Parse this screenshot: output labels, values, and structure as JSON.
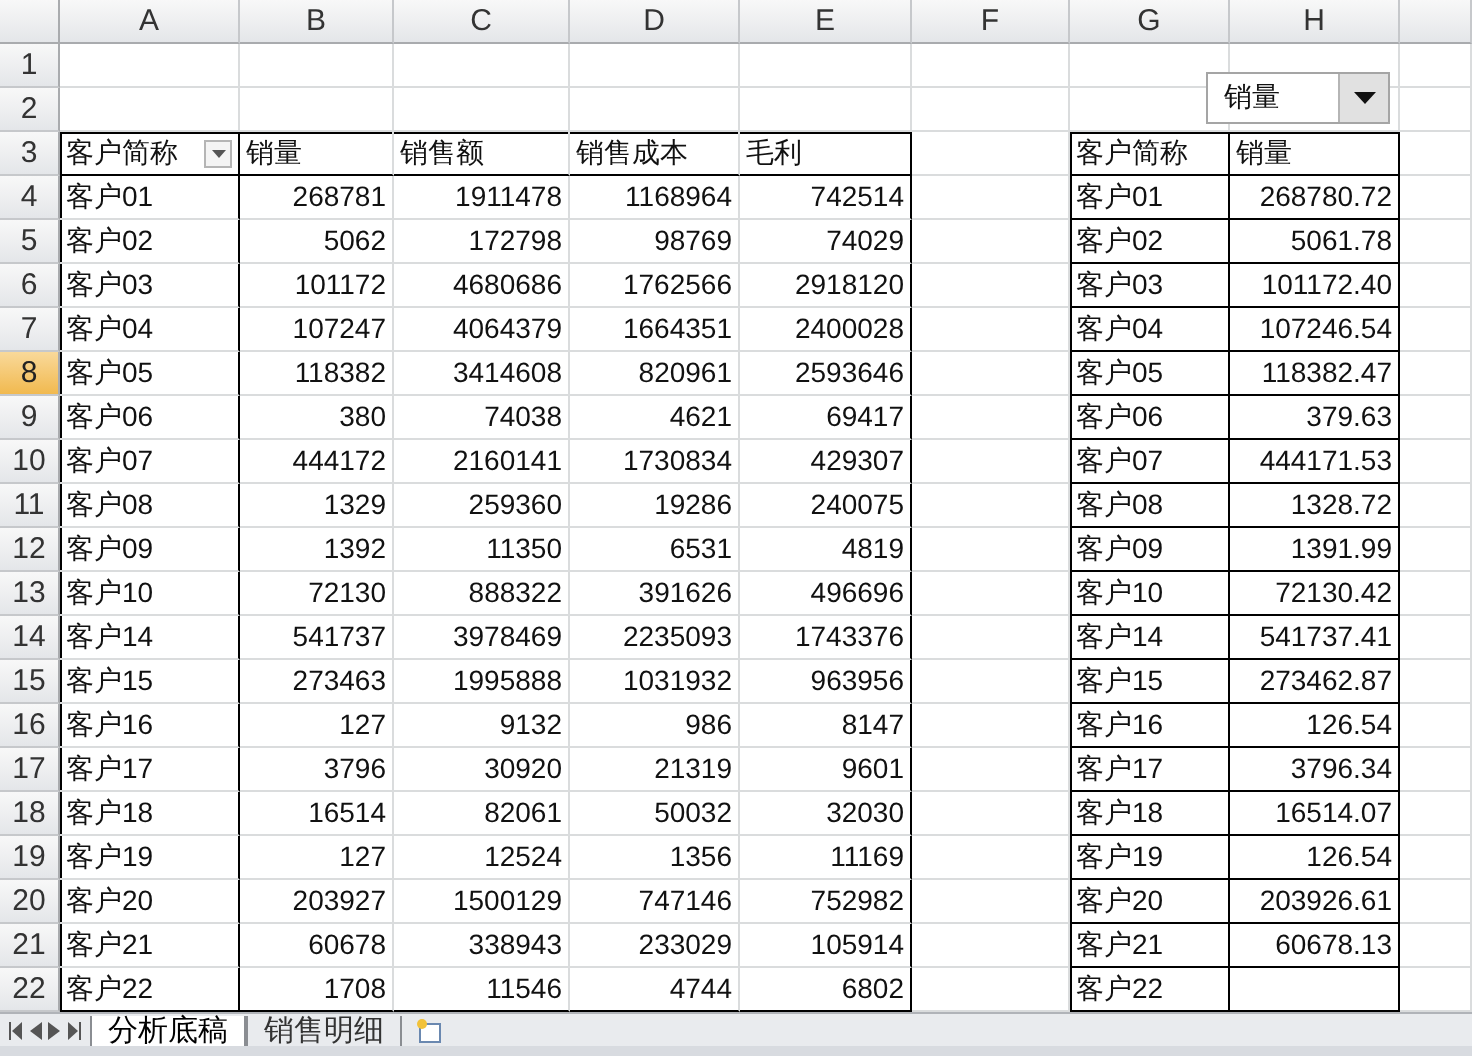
{
  "column_headers": [
    {
      "label": "A"
    },
    {
      "label": "B"
    },
    {
      "label": "C"
    },
    {
      "label": "D"
    },
    {
      "label": "E"
    },
    {
      "label": "F"
    },
    {
      "label": "G"
    },
    {
      "label": "H"
    }
  ],
  "row_headers": [
    {
      "label": "1",
      "selected": false
    },
    {
      "label": "2",
      "selected": false
    },
    {
      "label": "3",
      "selected": false
    },
    {
      "label": "4",
      "selected": false
    },
    {
      "label": "5",
      "selected": false
    },
    {
      "label": "6",
      "selected": false
    },
    {
      "label": "7",
      "selected": false
    },
    {
      "label": "8",
      "selected": true
    },
    {
      "label": "9",
      "selected": false
    },
    {
      "label": "10",
      "selected": false
    },
    {
      "label": "11",
      "selected": false
    },
    {
      "label": "12",
      "selected": false
    },
    {
      "label": "13",
      "selected": false
    },
    {
      "label": "14",
      "selected": false
    },
    {
      "label": "15",
      "selected": false
    },
    {
      "label": "16",
      "selected": false
    },
    {
      "label": "17",
      "selected": false
    },
    {
      "label": "18",
      "selected": false
    },
    {
      "label": "19",
      "selected": false
    },
    {
      "label": "20",
      "selected": false
    },
    {
      "label": "21",
      "selected": false
    },
    {
      "label": "22",
      "selected": false
    }
  ],
  "dropdown": {
    "value": "销量"
  },
  "left_table": {
    "header": [
      {
        "label": "客户简称",
        "filter": true
      },
      {
        "label": "销量",
        "filter": false
      },
      {
        "label": "销售额",
        "filter": false
      },
      {
        "label": "销售成本",
        "filter": false
      },
      {
        "label": "毛利",
        "filter": false
      }
    ],
    "rows": [
      [
        "客户01",
        "268781",
        "1911478",
        "1168964",
        "742514"
      ],
      [
        "客户02",
        "5062",
        "172798",
        "98769",
        "74029"
      ],
      [
        "客户03",
        "101172",
        "4680686",
        "1762566",
        "2918120"
      ],
      [
        "客户04",
        "107247",
        "4064379",
        "1664351",
        "2400028"
      ],
      [
        "客户05",
        "118382",
        "3414608",
        "820961",
        "2593646"
      ],
      [
        "客户06",
        "380",
        "74038",
        "4621",
        "69417"
      ],
      [
        "客户07",
        "444172",
        "2160141",
        "1730834",
        "429307"
      ],
      [
        "客户08",
        "1329",
        "259360",
        "19286",
        "240075"
      ],
      [
        "客户09",
        "1392",
        "11350",
        "6531",
        "4819"
      ],
      [
        "客户10",
        "72130",
        "888322",
        "391626",
        "496696"
      ],
      [
        "客户14",
        "541737",
        "3978469",
        "2235093",
        "1743376"
      ],
      [
        "客户15",
        "273463",
        "1995888",
        "1031932",
        "963956"
      ],
      [
        "客户16",
        "127",
        "9132",
        "986",
        "8147"
      ],
      [
        "客户17",
        "3796",
        "30920",
        "21319",
        "9601"
      ],
      [
        "客户18",
        "16514",
        "82061",
        "50032",
        "32030"
      ],
      [
        "客户19",
        "127",
        "12524",
        "1356",
        "11169"
      ],
      [
        "客户20",
        "203927",
        "1500129",
        "747146",
        "752982"
      ],
      [
        "客户21",
        "60678",
        "338943",
        "233029",
        "105914"
      ],
      [
        "客户22",
        "1708",
        "11546",
        "4744",
        "6802"
      ]
    ]
  },
  "right_table": {
    "header": [
      {
        "label": "客户简称",
        "filter": false
      },
      {
        "label": "销量",
        "filter": false
      }
    ],
    "rows": [
      [
        "客户01",
        "268780.72"
      ],
      [
        "客户02",
        "5061.78"
      ],
      [
        "客户03",
        "101172.40"
      ],
      [
        "客户04",
        "107246.54"
      ],
      [
        "客户05",
        "118382.47"
      ],
      [
        "客户06",
        "379.63"
      ],
      [
        "客户07",
        "444171.53"
      ],
      [
        "客户08",
        "1328.72"
      ],
      [
        "客户09",
        "1391.99"
      ],
      [
        "客户10",
        "72130.42"
      ],
      [
        "客户14",
        "541737.41"
      ],
      [
        "客户15",
        "273462.87"
      ],
      [
        "客户16",
        "126.54"
      ],
      [
        "客户17",
        "3796.34"
      ],
      [
        "客户18",
        "16514.07"
      ],
      [
        "客户19",
        "126.54"
      ],
      [
        "客户20",
        "203926.61"
      ],
      [
        "客户21",
        "60678.13"
      ],
      [
        "客户22"
      ]
    ]
  },
  "sheet_tabs": [
    {
      "label": "分析底稿",
      "selected": true
    },
    {
      "label": "销售明细",
      "selected": false
    }
  ]
}
